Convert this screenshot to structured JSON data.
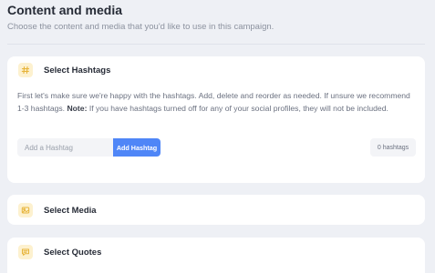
{
  "header": {
    "title": "Content and media",
    "subtitle": "Choose the content and media that you'd like to use in this campaign."
  },
  "sections": {
    "hashtags": {
      "title": "Select Hashtags",
      "icon": "hashtag-icon",
      "description_intro": "First let's make sure we're happy with the hashtags. Add, delete and reorder as needed. If unsure we recommend 1-3 hashtags.",
      "note_label": "Note:",
      "note_text": "If you have hashtags turned off for any of your social profiles, they will not be included.",
      "input_placeholder": "Add a Hashtag",
      "input_value": "",
      "add_button_label": "Add Hashtag",
      "count_label": "0 hashtags"
    },
    "media": {
      "title": "Select Media",
      "icon": "image-icon"
    },
    "quotes": {
      "title": "Select Quotes",
      "icon": "quote-icon"
    }
  },
  "colors": {
    "background": "#eef0f5",
    "card": "#ffffff",
    "accent": "#4f86f7",
    "icon_tile": "#fdf1cf",
    "icon_stroke": "#e7b43a"
  }
}
